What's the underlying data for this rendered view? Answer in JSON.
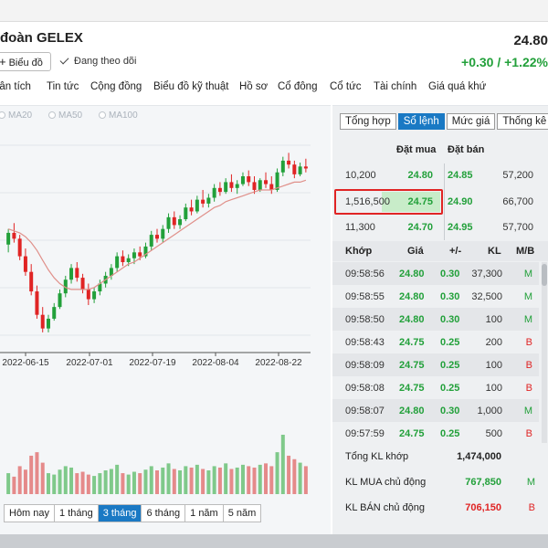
{
  "header": {
    "title": "đoàn GELEX",
    "price": "24.80",
    "change": "+0.30 / +1.22%",
    "chart_button": "Biểu đồ",
    "follow_label": "Đang theo dõi"
  },
  "nav": [
    "hân tích",
    "Tin tức",
    "Cộng đồng",
    "Biểu đồ kỹ thuật",
    "Hồ sơ",
    "Cổ đông",
    "Cổ tức",
    "Tài chính",
    "Giá quá khứ"
  ],
  "ma_labels": [
    "MA20",
    "MA50",
    "MA100"
  ],
  "range_buttons": [
    "Hôm nay",
    "1 tháng",
    "3 tháng",
    "6 tháng",
    "1 năm",
    "5 năm"
  ],
  "range_active": "3 tháng",
  "tabs": [
    "Tổng hợp",
    "Sổ lệnh",
    "Mức giá",
    "Thống kê"
  ],
  "tab_active": "Sổ lệnh",
  "orderbook": {
    "bid_header": "Đặt mua",
    "ask_header": "Đặt bán",
    "rows": [
      {
        "bid_vol": "10,200",
        "bid": "24.80",
        "ask": "24.85",
        "ask_vol": "57,200"
      },
      {
        "bid_vol": "1,516,500",
        "bid": "24.75",
        "ask": "24.90",
        "ask_vol": "66,700"
      },
      {
        "bid_vol": "11,300",
        "bid": "24.70",
        "ask": "24.95",
        "ask_vol": "57,700"
      }
    ]
  },
  "trades": {
    "headers": {
      "time": "Khớp",
      "price": "Giá",
      "change": "+/-",
      "volume": "KL",
      "side": "M/B"
    },
    "rows": [
      {
        "time": "09:58:56",
        "price": "24.80",
        "change": "0.30",
        "volume": "37,300",
        "side": "M"
      },
      {
        "time": "09:58:55",
        "price": "24.80",
        "change": "0.30",
        "volume": "32,500",
        "side": "M"
      },
      {
        "time": "09:58:50",
        "price": "24.80",
        "change": "0.30",
        "volume": "100",
        "side": "M"
      },
      {
        "time": "09:58:43",
        "price": "24.75",
        "change": "0.25",
        "volume": "200",
        "side": "B"
      },
      {
        "time": "09:58:09",
        "price": "24.75",
        "change": "0.25",
        "volume": "100",
        "side": "B"
      },
      {
        "time": "09:58:08",
        "price": "24.75",
        "change": "0.25",
        "volume": "100",
        "side": "B"
      },
      {
        "time": "09:58:07",
        "price": "24.80",
        "change": "0.30",
        "volume": "1,000",
        "side": "M"
      },
      {
        "time": "09:57:59",
        "price": "24.75",
        "change": "0.25",
        "volume": "500",
        "side": "B"
      }
    ]
  },
  "summary": {
    "total_label": "Tổng KL khớp",
    "total_value": "1,474,000",
    "buy_label": "KL MUA chủ động",
    "buy_value": "767,850",
    "buy_side": "M",
    "sell_label": "KL BÁN chủ động",
    "sell_value": "706,150",
    "sell_side": "B"
  },
  "colors": {
    "up": "#22a03a",
    "down": "#e02424",
    "accent": "#1a79c4"
  },
  "chart_data": {
    "type": "candlestick",
    "x_ticks": [
      "2022-06-15",
      "2022-07-01",
      "2022-07-19",
      "2022-08-04",
      "2022-08-22"
    ],
    "candles": [
      {
        "o": 17.8,
        "h": 18.6,
        "l": 17.4,
        "c": 18.4
      },
      {
        "o": 18.4,
        "h": 18.9,
        "l": 17.9,
        "c": 18.1
      },
      {
        "o": 18.1,
        "h": 18.3,
        "l": 17.0,
        "c": 17.2
      },
      {
        "o": 17.2,
        "h": 17.6,
        "l": 16.2,
        "c": 16.4
      },
      {
        "o": 16.4,
        "h": 16.8,
        "l": 15.2,
        "c": 15.4
      },
      {
        "o": 15.4,
        "h": 15.7,
        "l": 14.0,
        "c": 14.2
      },
      {
        "o": 14.2,
        "h": 14.6,
        "l": 13.3,
        "c": 13.5
      },
      {
        "o": 13.5,
        "h": 14.2,
        "l": 13.3,
        "c": 14.0
      },
      {
        "o": 14.0,
        "h": 14.8,
        "l": 13.9,
        "c": 14.6
      },
      {
        "o": 14.6,
        "h": 15.5,
        "l": 14.5,
        "c": 15.3
      },
      {
        "o": 15.3,
        "h": 16.2,
        "l": 15.1,
        "c": 16.0
      },
      {
        "o": 16.0,
        "h": 16.8,
        "l": 15.8,
        "c": 16.6
      },
      {
        "o": 16.6,
        "h": 16.9,
        "l": 15.9,
        "c": 16.1
      },
      {
        "o": 16.1,
        "h": 16.3,
        "l": 15.3,
        "c": 15.5
      },
      {
        "o": 15.5,
        "h": 15.8,
        "l": 14.7,
        "c": 15.0
      },
      {
        "o": 15.0,
        "h": 15.6,
        "l": 14.8,
        "c": 15.4
      },
      {
        "o": 15.4,
        "h": 16.0,
        "l": 15.2,
        "c": 15.8
      },
      {
        "o": 15.8,
        "h": 16.4,
        "l": 15.6,
        "c": 16.2
      },
      {
        "o": 16.2,
        "h": 16.8,
        "l": 16.0,
        "c": 16.6
      },
      {
        "o": 16.6,
        "h": 17.4,
        "l": 16.4,
        "c": 17.2
      },
      {
        "o": 17.2,
        "h": 17.5,
        "l": 16.7,
        "c": 16.9
      },
      {
        "o": 16.9,
        "h": 17.3,
        "l": 16.7,
        "c": 17.1
      },
      {
        "o": 17.1,
        "h": 17.6,
        "l": 16.8,
        "c": 17.4
      },
      {
        "o": 17.4,
        "h": 17.7,
        "l": 17.0,
        "c": 17.2
      },
      {
        "o": 17.2,
        "h": 17.9,
        "l": 17.1,
        "c": 17.7
      },
      {
        "o": 17.7,
        "h": 18.5,
        "l": 17.5,
        "c": 18.3
      },
      {
        "o": 18.3,
        "h": 18.6,
        "l": 17.9,
        "c": 18.1
      },
      {
        "o": 18.1,
        "h": 18.8,
        "l": 17.9,
        "c": 18.6
      },
      {
        "o": 18.6,
        "h": 19.4,
        "l": 18.4,
        "c": 19.2
      },
      {
        "o": 19.2,
        "h": 19.5,
        "l": 18.6,
        "c": 18.8
      },
      {
        "o": 18.8,
        "h": 19.3,
        "l": 18.6,
        "c": 19.1
      },
      {
        "o": 19.1,
        "h": 19.9,
        "l": 19.0,
        "c": 19.7
      },
      {
        "o": 19.7,
        "h": 20.1,
        "l": 19.3,
        "c": 19.5
      },
      {
        "o": 19.5,
        "h": 20.3,
        "l": 19.4,
        "c": 20.1
      },
      {
        "o": 20.1,
        "h": 20.6,
        "l": 19.7,
        "c": 19.9
      },
      {
        "o": 19.9,
        "h": 20.4,
        "l": 19.7,
        "c": 20.2
      },
      {
        "o": 20.2,
        "h": 20.9,
        "l": 20.0,
        "c": 20.7
      },
      {
        "o": 20.7,
        "h": 21.0,
        "l": 20.3,
        "c": 20.5
      },
      {
        "o": 20.5,
        "h": 21.2,
        "l": 20.4,
        "c": 21.0
      },
      {
        "o": 21.0,
        "h": 21.4,
        "l": 20.5,
        "c": 20.7
      },
      {
        "o": 20.7,
        "h": 21.1,
        "l": 20.4,
        "c": 20.9
      },
      {
        "o": 20.9,
        "h": 21.5,
        "l": 20.8,
        "c": 21.3
      },
      {
        "o": 21.3,
        "h": 21.6,
        "l": 20.8,
        "c": 21.0
      },
      {
        "o": 21.0,
        "h": 21.3,
        "l": 20.4,
        "c": 20.6
      },
      {
        "o": 20.6,
        "h": 21.2,
        "l": 20.5,
        "c": 21.1
      },
      {
        "o": 21.1,
        "h": 21.5,
        "l": 20.7,
        "c": 20.9
      },
      {
        "o": 20.9,
        "h": 21.3,
        "l": 20.4,
        "c": 20.6
      },
      {
        "o": 20.6,
        "h": 21.7,
        "l": 20.5,
        "c": 21.5
      },
      {
        "o": 21.5,
        "h": 22.3,
        "l": 21.3,
        "c": 22.1
      },
      {
        "o": 22.1,
        "h": 22.5,
        "l": 21.7,
        "c": 21.9
      },
      {
        "o": 21.9,
        "h": 22.1,
        "l": 21.2,
        "c": 21.4
      },
      {
        "o": 21.4,
        "h": 22.0,
        "l": 21.3,
        "c": 21.8
      },
      {
        "o": 21.8,
        "h": 22.2,
        "l": 21.5,
        "c": 21.7
      }
    ],
    "ma": [
      18.6,
      18.5,
      18.4,
      18.2,
      17.9,
      17.5,
      17.0,
      16.5,
      16.1,
      15.8,
      15.6,
      15.5,
      15.5,
      15.5,
      15.5,
      15.6,
      15.8,
      16.0,
      16.2,
      16.4,
      16.6,
      16.8,
      16.9,
      17.1,
      17.3,
      17.5,
      17.7,
      17.9,
      18.1,
      18.3,
      18.5,
      18.7,
      18.9,
      19.1,
      19.3,
      19.5,
      19.7,
      19.8,
      20.0,
      20.1,
      20.2,
      20.3,
      20.4,
      20.5,
      20.6,
      20.6,
      20.6,
      20.7,
      20.8,
      20.9,
      21.0,
      21.0,
      21.1
    ],
    "volume": [
      30,
      25,
      40,
      35,
      55,
      60,
      45,
      30,
      28,
      35,
      40,
      38,
      30,
      32,
      28,
      26,
      30,
      34,
      36,
      42,
      30,
      28,
      32,
      30,
      35,
      40,
      34,
      38,
      44,
      36,
      34,
      40,
      38,
      42,
      36,
      34,
      40,
      38,
      44,
      36,
      38,
      42,
      40,
      38,
      42,
      44,
      40,
      60,
      85,
      55,
      50,
      45,
      40
    ],
    "y_range": [
      12.5,
      23.5
    ]
  }
}
